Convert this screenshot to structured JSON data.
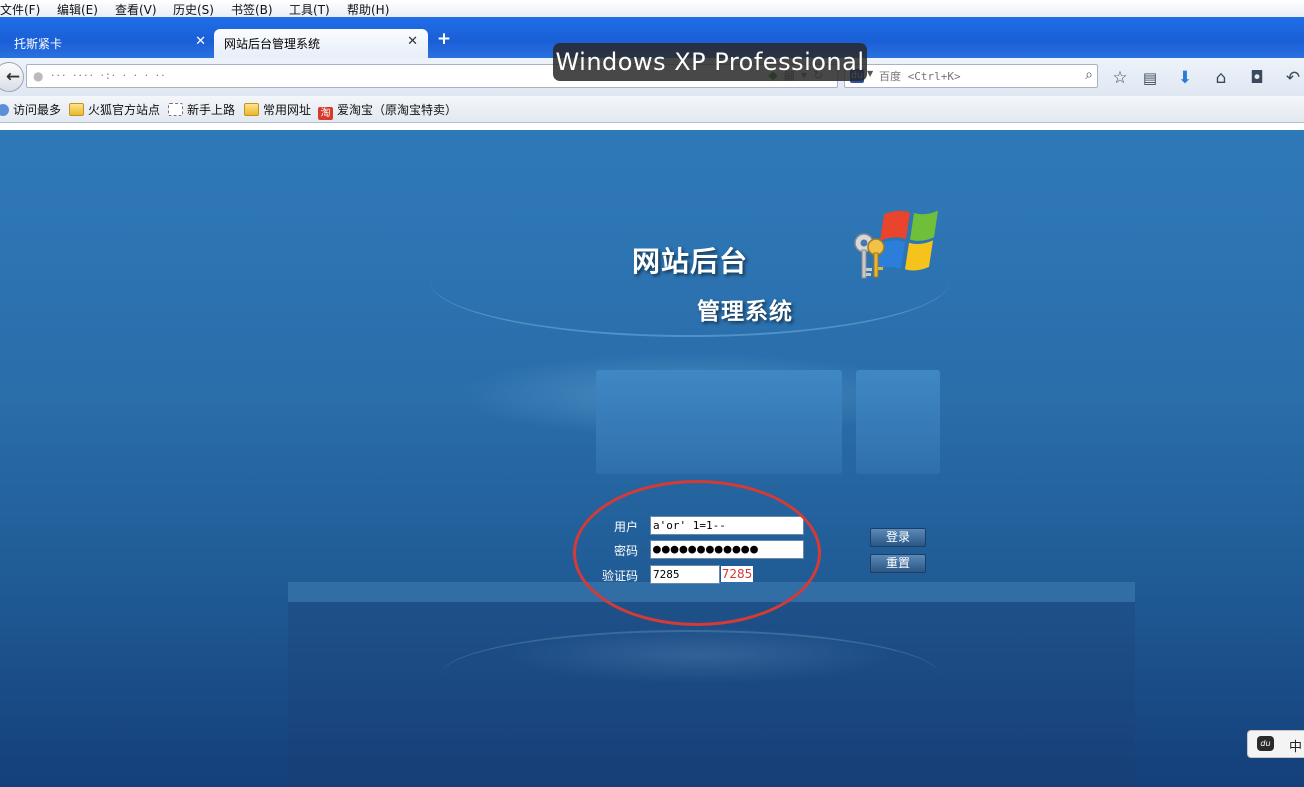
{
  "menubar": {
    "items": [
      "文件(F)",
      "编辑(E)",
      "查看(V)",
      "历史(S)",
      "书签(B)",
      "工具(T)",
      "帮助(H)"
    ]
  },
  "tabs": [
    {
      "label": "托斯紧卡",
      "close": "✕"
    },
    {
      "label": "网站后台管理系统",
      "close": "✕"
    }
  ],
  "new_tab": "+",
  "os_badge": "Windows XP Professional",
  "navbar": {
    "url": "··· ···· ·:· · · · ··",
    "search_placeholder": "百度 <Ctrl+K>"
  },
  "bookmarks": [
    "访问最多",
    "火狐官方站点",
    "新手上路",
    "常用网址",
    "爱淘宝（原淘宝特卖）"
  ],
  "page": {
    "heading_line1": "网站后台",
    "heading_line2": "管理系统",
    "form": {
      "username_label": "用户",
      "password_label": "密码",
      "captcha_label": "验证码",
      "username_value": "a'or' 1=1--",
      "password_value": "●●●●●●●●●●●●",
      "captcha_value": "7285",
      "captcha_image_text": "7285",
      "login_button": "登录",
      "reset_button": "重置"
    }
  },
  "ime": {
    "label": "中"
  },
  "colors": {
    "tabstrip": "#1a5fd6",
    "page_background": "#2a6eaa",
    "annotation_circle": "#d43b37"
  }
}
